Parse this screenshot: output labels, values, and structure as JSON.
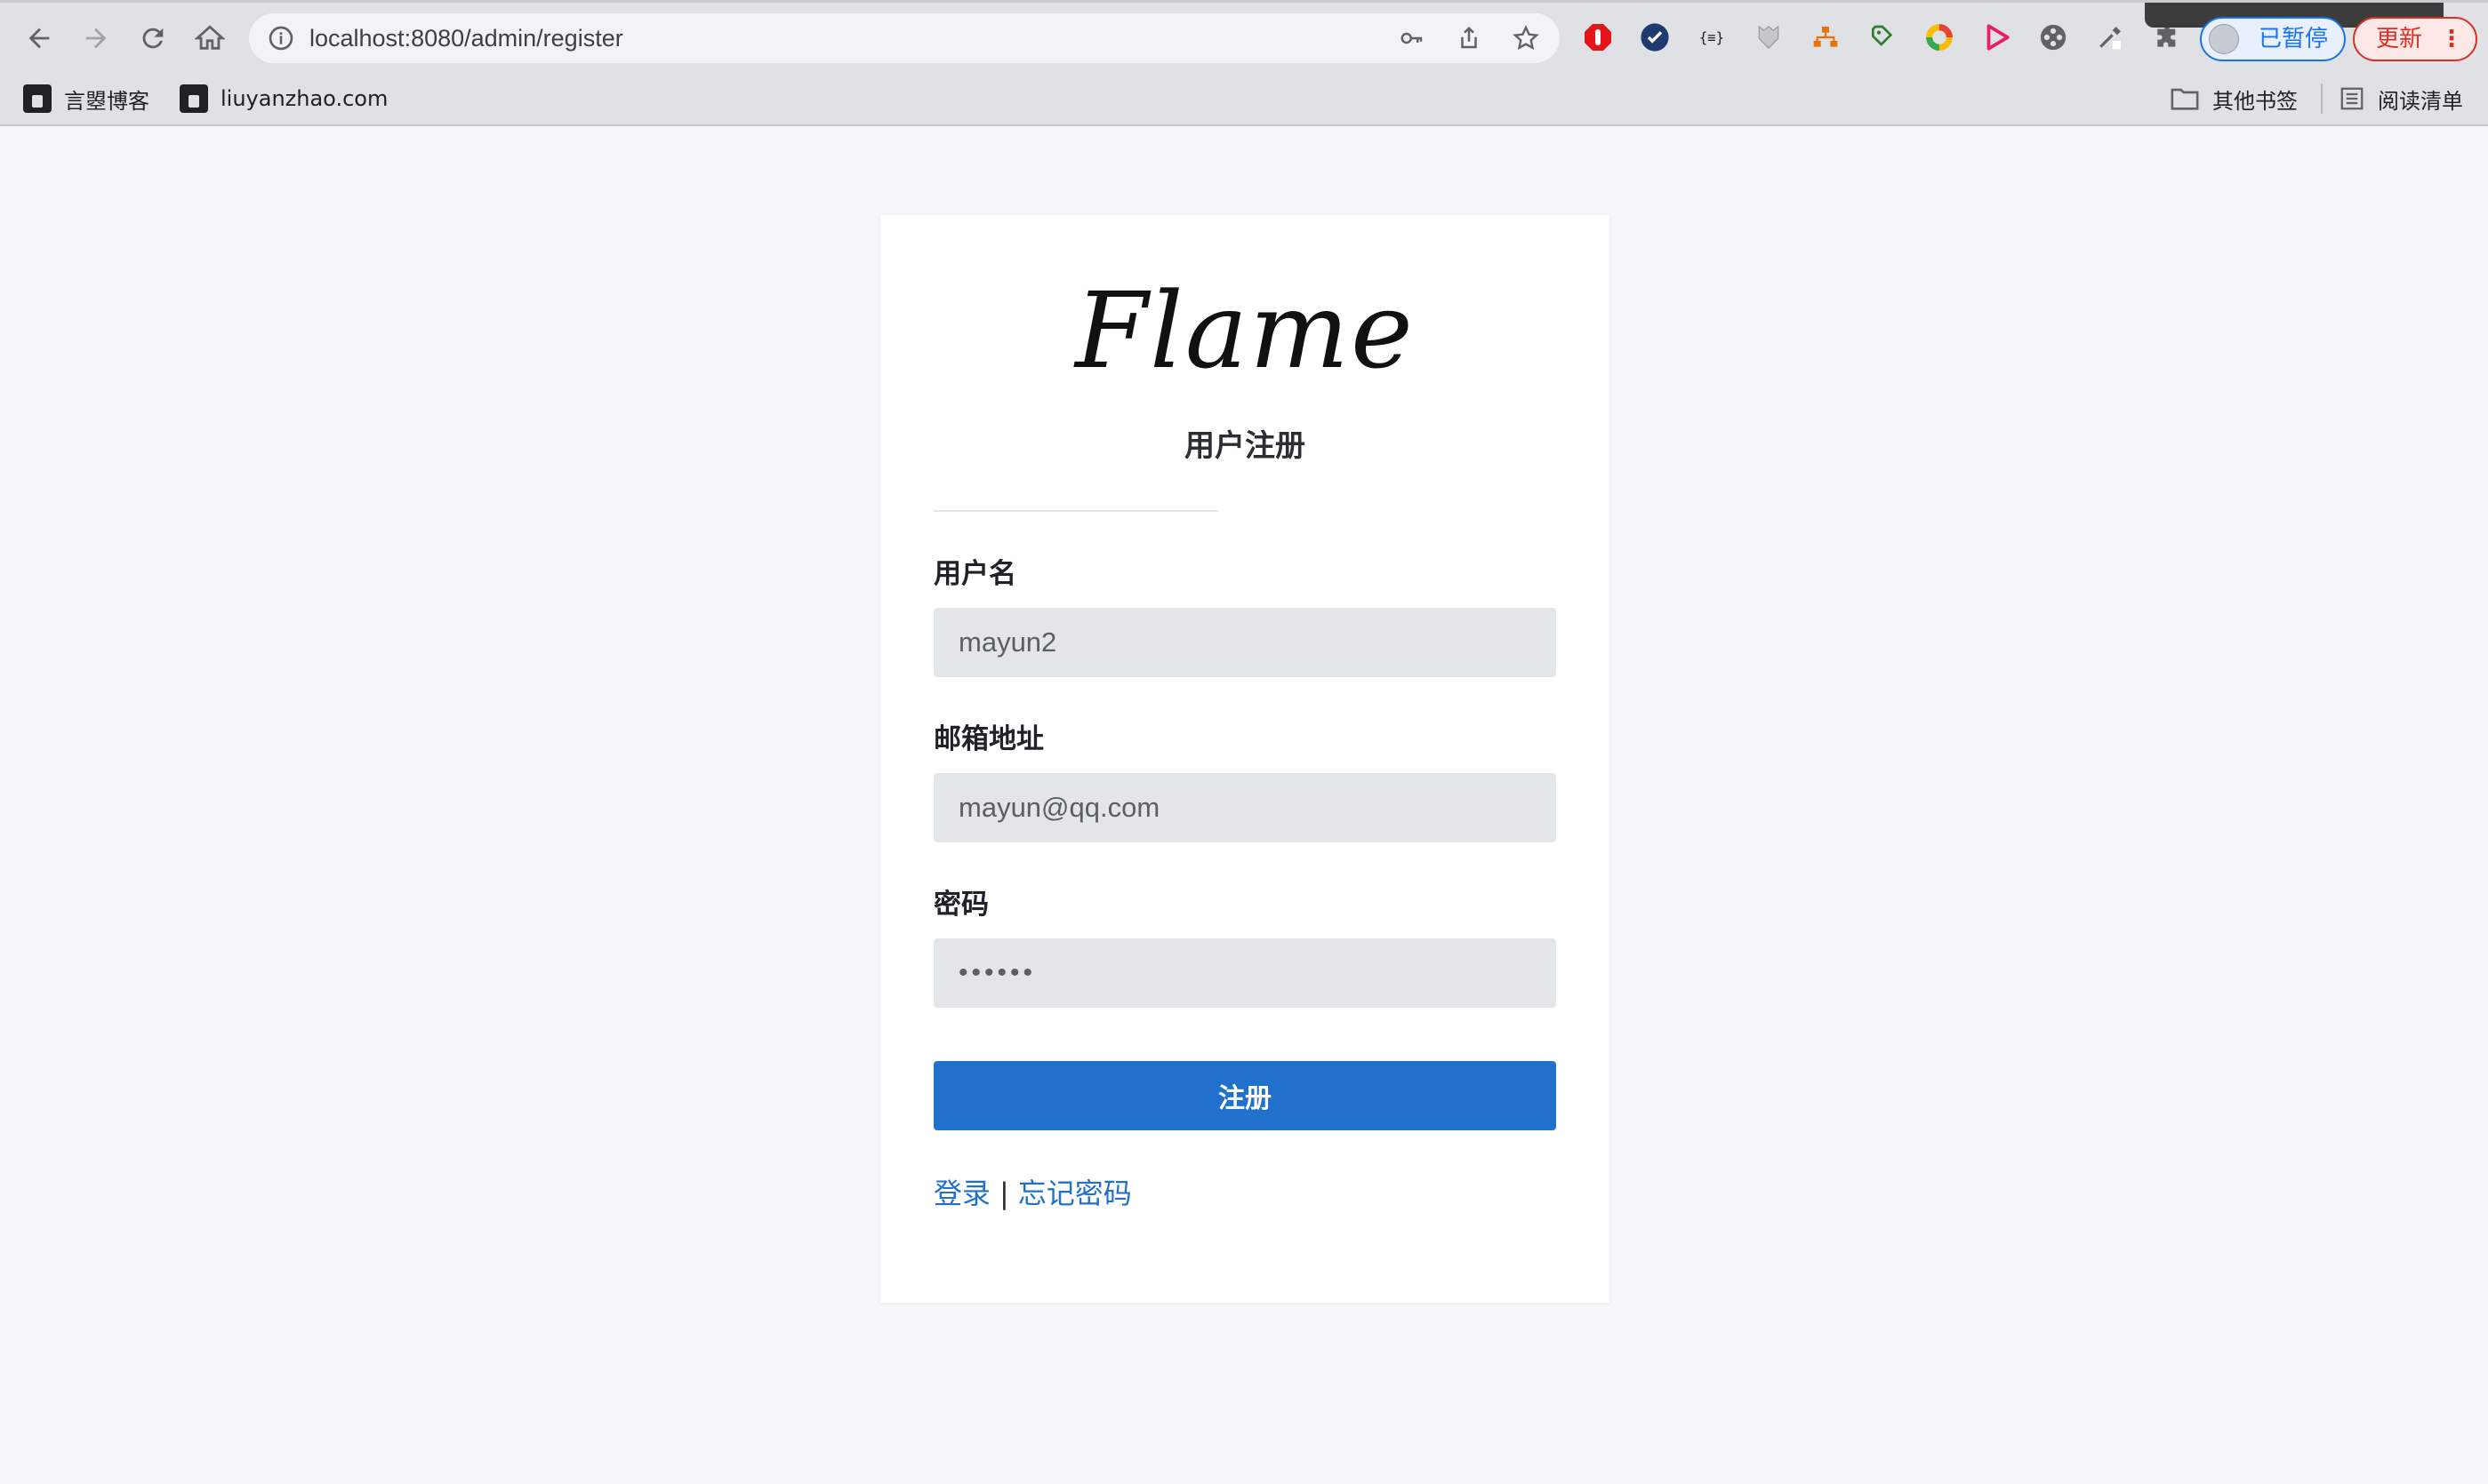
{
  "browser": {
    "url": "localhost:8080/admin/register",
    "profile_label": "已暂停",
    "update_label": "更新",
    "update_menu_glyph": "⋮",
    "bookmarks": [
      "言曌博客",
      "liuyanzhao.com"
    ],
    "bookmarks_right": [
      "其他书签",
      "阅读清单"
    ]
  },
  "page": {
    "logo_text": "Flame",
    "title": "用户注册",
    "fields": {
      "username": {
        "label": "用户名",
        "value": "mayun2"
      },
      "email": {
        "label": "邮箱地址",
        "value": "mayun@qq.com"
      },
      "password": {
        "label": "密码",
        "value": "••••••"
      }
    },
    "submit_label": "注册",
    "links": {
      "login": "登录",
      "separator": "|",
      "forgot": "忘记密码"
    }
  },
  "colors": {
    "primary": "#2170cc",
    "field_bg": "#e3e6e9",
    "page_bg": "#f7f8fa",
    "chrome_bg": "#dfe1e5"
  }
}
